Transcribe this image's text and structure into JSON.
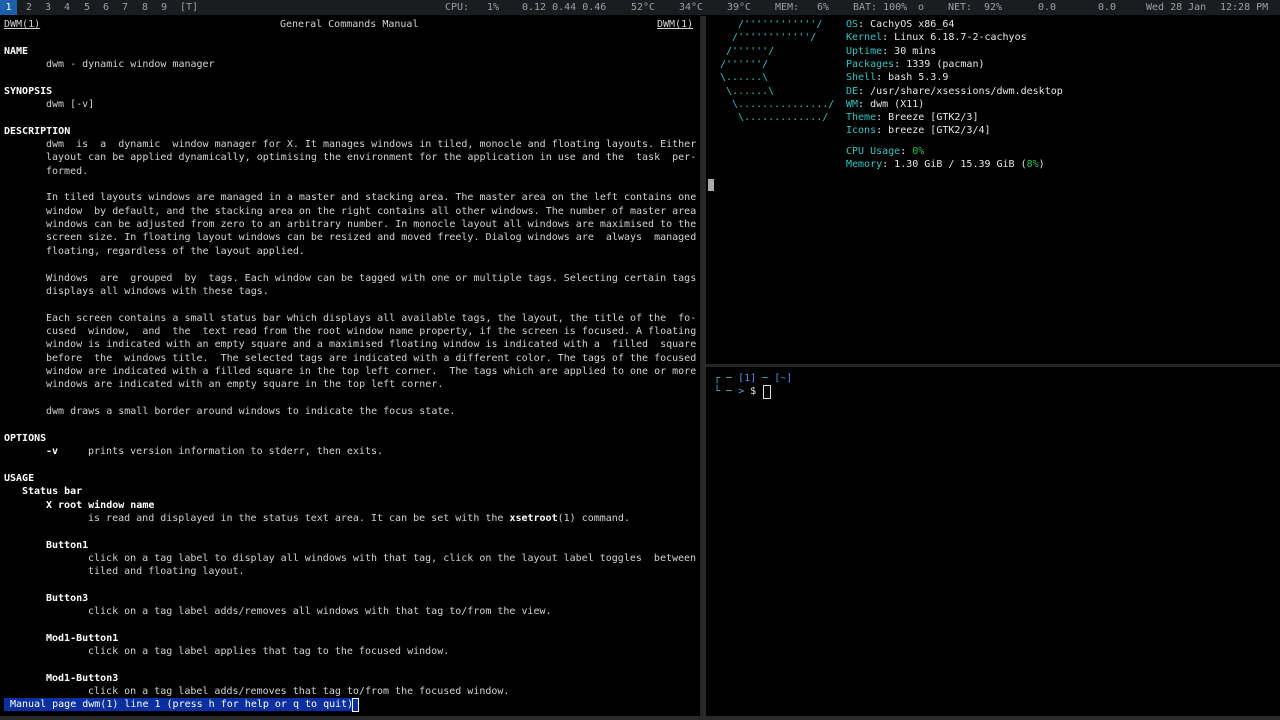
{
  "bar": {
    "tags": [
      "1",
      "2",
      "3",
      "4",
      "5",
      "6",
      "7",
      "8",
      "9",
      "[T]"
    ],
    "status": {
      "cpu_label": "CPU:",
      "cpu": "1%",
      "load": "0.12 0.44 0.46",
      "temp1": "52°C",
      "temp2": "34°C",
      "temp3": "39°C",
      "mem_label": "MEM:",
      "mem": "6%",
      "bat_label": "BAT: 100%",
      "bat_icon": "o",
      "net_label": "NET:",
      "net": "92%",
      "net_up": "0.0",
      "net_down": "0.0",
      "date": "Wed 28 Jan",
      "time": "12:28 PM"
    },
    "selected_color": "#1d5fa8"
  },
  "man": {
    "header_left": "DWM(1)",
    "header_center": "General Commands Manual",
    "header_right": "DWM(1)",
    "name_h": "NAME",
    "name_t": "dwm - dynamic window manager",
    "syn_h": "SYNOPSIS",
    "syn_t": "dwm [-v]",
    "desc_h": "DESCRIPTION",
    "desc": [
      "dwm  is  a  dynamic  window manager for X. It manages windows in tiled, monocle and floating layouts. Either",
      "layout can be applied dynamically, optimising the environment for the application in use and the  task  per-",
      "formed.",
      "",
      "In tiled layouts windows are managed in a master and stacking area. The master area on the left contains one",
      "window  by default, and the stacking area on the right contains all other windows. The number of master area",
      "windows can be adjusted from zero to an arbitrary number. In monocle layout all windows are maximised to the",
      "screen size. In floating layout windows can be resized and moved freely. Dialog windows are  always  managed",
      "floating, regardless of the layout applied.",
      "",
      "Windows  are  grouped  by  tags. Each window can be tagged with one or multiple tags. Selecting certain tags",
      "displays all windows with these tags.",
      "",
      "Each screen contains a small status bar which displays all available tags, the layout, the title of the  fo-",
      "cused  window,  and  the  text read from the root window name property, if the screen is focused. A floating",
      "window is indicated with an empty square and a maximised floating window is indicated with a  filled  square",
      "before  the  windows title.  The selected tags are indicated with a different color. The tags of the focused",
      "window are indicated with a filled square in the top left corner.  The tags which are applied to one or more",
      "windows are indicated with an empty square in the top left corner.",
      "",
      "dwm draws a small border around windows to indicate the focus state."
    ],
    "opt_h": "OPTIONS",
    "opt_flag": "-v",
    "opt_t": "prints version information to stderr, then exits.",
    "usage_h": "USAGE",
    "statusbar_h": "Status bar",
    "xroot_h": "X root window name",
    "xroot_t1": "is read and displayed in the status text area. It can be set with the ",
    "xroot_cmd": "xsetroot",
    "xroot_t2": "(1) command.",
    "b1_h": "Button1",
    "b1_t1": "click on a tag label to display all windows with that tag, click on the layout label toggles  between",
    "b1_t2": "tiled and floating layout.",
    "b3_h": "Button3",
    "b3_t": "click on a tag label adds/removes all windows with that tag to/from the view.",
    "m1_h": "Mod1-Button1",
    "m1_t": "click on a tag label applies that tag to the focused window.",
    "m3_h": "Mod1-Button3",
    "m3_t": "click on a tag label adds/removes that tag to/from the focused window.",
    "status_line": "Manual page dwm(1) line 1 (press h for help or q to quit)"
  },
  "fetch": {
    "logo": [
      "   /''''''''''''/",
      "  /''''''''''''/",
      " /''''''/",
      "/''''''/",
      "\\......\\",
      " \\......\\",
      "  \\.............../",
      "   \\............./"
    ],
    "rows": [
      {
        "k": "OS",
        "v": "CachyOS x86_64"
      },
      {
        "k": "Kernel",
        "v": "Linux 6.18.7-2-cachyos"
      },
      {
        "k": "Uptime",
        "v": "30 mins"
      },
      {
        "k": "Packages",
        "v": "1339 (pacman)"
      },
      {
        "k": "Shell",
        "v": "bash 5.3.9"
      },
      {
        "k": "DE",
        "v": "/usr/share/xsessions/dwm.desktop"
      },
      {
        "k": "WM",
        "v": "dwm (X11)"
      },
      {
        "k": "Theme",
        "v": "Breeze [GTK2/3]"
      },
      {
        "k": "Icons",
        "v": "breeze [GTK2/3/4]"
      }
    ],
    "cpu_k": "CPU Usage",
    "cpu_v": "0%",
    "mem_k": "Memory",
    "mem_v": "1.30 GiB / 15.39 GiB (",
    "mem_pct": "8%",
    "mem_end": ")"
  },
  "shell": {
    "line1_a": "┌ ─ ",
    "line1_b": "[1]",
    "line1_c": " ─ ",
    "line1_d": "[~]",
    "line2_a": "└ ─ > ",
    "line2_b": "$ "
  }
}
